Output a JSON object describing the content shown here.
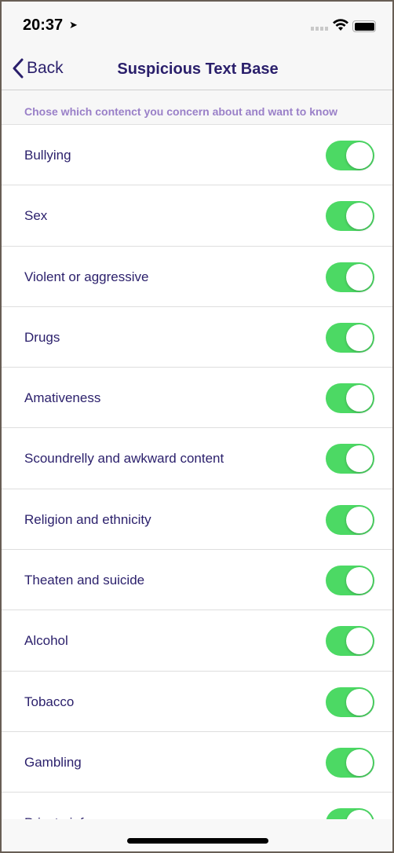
{
  "status": {
    "time": "20:37"
  },
  "nav": {
    "back_label": "Back",
    "title": "Suspicious Text Base"
  },
  "hint": "Chose which contenct you concern about and want to know",
  "colors": {
    "accent": "#2a1f6b",
    "toggle_on": "#4cd964",
    "hint": "#9a80c8"
  },
  "items": [
    {
      "label": "Bullying",
      "on": true
    },
    {
      "label": "Sex",
      "on": true
    },
    {
      "label": "Violent or aggressive",
      "on": true
    },
    {
      "label": "Drugs",
      "on": true
    },
    {
      "label": "Amativeness",
      "on": true
    },
    {
      "label": "Scoundrelly and awkward content",
      "on": true
    },
    {
      "label": "Religion and ethnicity",
      "on": true
    },
    {
      "label": "Theaten and suicide",
      "on": true
    },
    {
      "label": "Alcohol",
      "on": true
    },
    {
      "label": "Tobacco",
      "on": true
    },
    {
      "label": "Gambling",
      "on": true
    },
    {
      "label": "Private info",
      "on": true
    }
  ]
}
